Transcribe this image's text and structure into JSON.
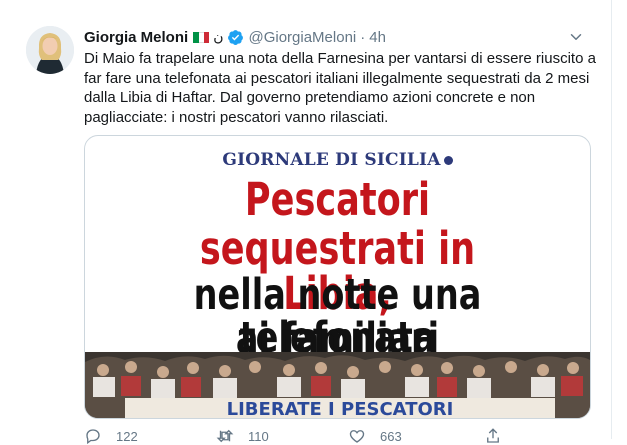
{
  "tweet": {
    "author_name": "Giorgia Meloni",
    "author_suffix": "ن",
    "handle": "@GiorgiaMeloni",
    "separator": "·",
    "time": "4h",
    "text": "Di Maio fa trapelare una nota della Farnesina per vantarsi di essere riuscito a far fare una telefonata ai pescatori italiani illegalmente sequestrati da 2 mesi dalla Libia di Haftar. Dal governo pretendiamo azioni concrete e non pagliacciate: i nostri pescatori vanno rilasciati."
  },
  "media": {
    "newspaper": "GIORNALE DI SICILIA",
    "headline_line1": "Pescatori",
    "headline_line2": "sequestrati in Libia,",
    "headline_line3": "nella notte una telefonata",
    "headline_line4": "ai familiari",
    "banner_text": "LIBERATE I PESCATORI"
  },
  "actions": {
    "replies": "122",
    "retweets": "110",
    "likes": "663"
  },
  "colors": {
    "brand_blue": "#1da1f2",
    "headline_red": "#c4161c",
    "newspaper_blue": "#2d3a7a"
  },
  "icons": [
    "verified-badge-icon",
    "italian-flag-icon",
    "caret-down-icon",
    "reply-icon",
    "retweet-icon",
    "like-icon",
    "share-icon"
  ]
}
